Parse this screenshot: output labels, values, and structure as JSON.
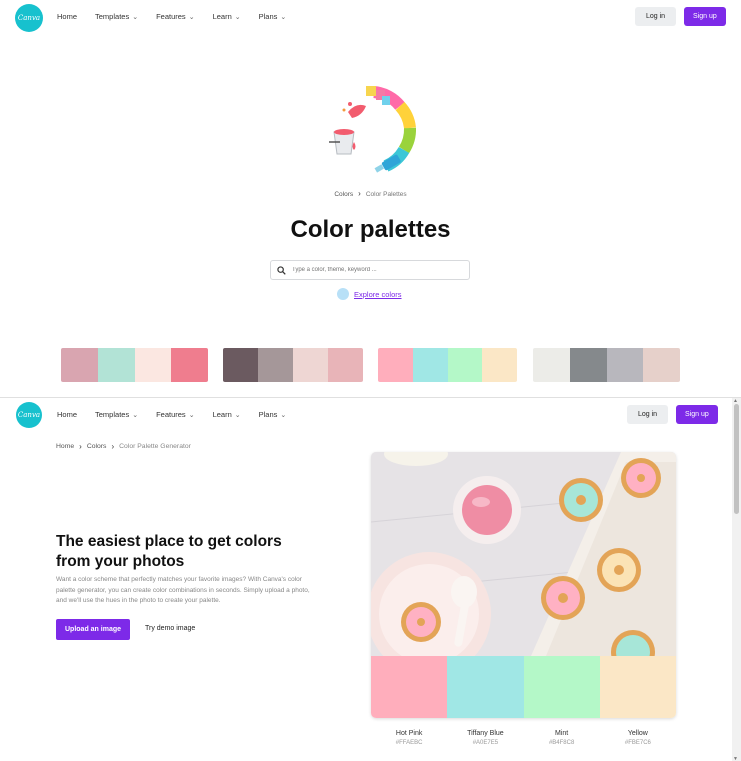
{
  "brand": {
    "logo_text": "Canva",
    "accent": "#7d2ae8",
    "logo_color": "#17c1ce"
  },
  "nav": {
    "items": [
      {
        "label": "Home",
        "has_dropdown": false
      },
      {
        "label": "Templates",
        "has_dropdown": true
      },
      {
        "label": "Features",
        "has_dropdown": true
      },
      {
        "label": "Learn",
        "has_dropdown": true
      },
      {
        "label": "Plans",
        "has_dropdown": true
      }
    ],
    "login_label": "Log in",
    "signup_label": "Sign up",
    "chevron": "⌄"
  },
  "hero": {
    "breadcrumb": [
      "Colors",
      "Color Palettes"
    ],
    "breadcrumb_sep": "›",
    "title": "Color palettes",
    "search_placeholder": "Type a color, theme, keyword ...",
    "explore_label": "Explore colors"
  },
  "palettes": [
    [
      "#d9a5b0",
      "#b2e3d6",
      "#fbe7e1",
      "#ef7d8e"
    ],
    [
      "#6b5a60",
      "#a59799",
      "#eed6d3",
      "#e8b4b8"
    ],
    [
      "#ffaebc",
      "#a0e7e5",
      "#b4f8c8",
      "#fbe7c6"
    ],
    [
      "#ecece8",
      "#85898c",
      "#b8b7bd",
      "#e6d0ca"
    ]
  ],
  "generator": {
    "breadcrumb": [
      "Home",
      "Colors",
      "Color Palette Generator"
    ],
    "breadcrumb_sep": "›",
    "title": "The easiest place to get colors from your photos",
    "description": "Want a color scheme that perfectly matches your favorite images? With Canva's color palette generator, you can create color combinations in seconds. Simply upload a photo, and we'll use the hues in the photo to create your palette.",
    "upload_label": "Upload an image",
    "demo_label": "Try demo image",
    "colors": [
      {
        "name": "Hot Pink",
        "hex": "#FFAEBC"
      },
      {
        "name": "Tiffany Blue",
        "hex": "#A0E7E5"
      },
      {
        "name": "Mint",
        "hex": "#B4F8C8"
      },
      {
        "name": "Yellow",
        "hex": "#FBE7C6"
      }
    ]
  },
  "icons": [
    "search-icon",
    "chevron-right-icon",
    "chevron-down-icon",
    "paint-bucket-illustration",
    "palette-dot-icon"
  ]
}
